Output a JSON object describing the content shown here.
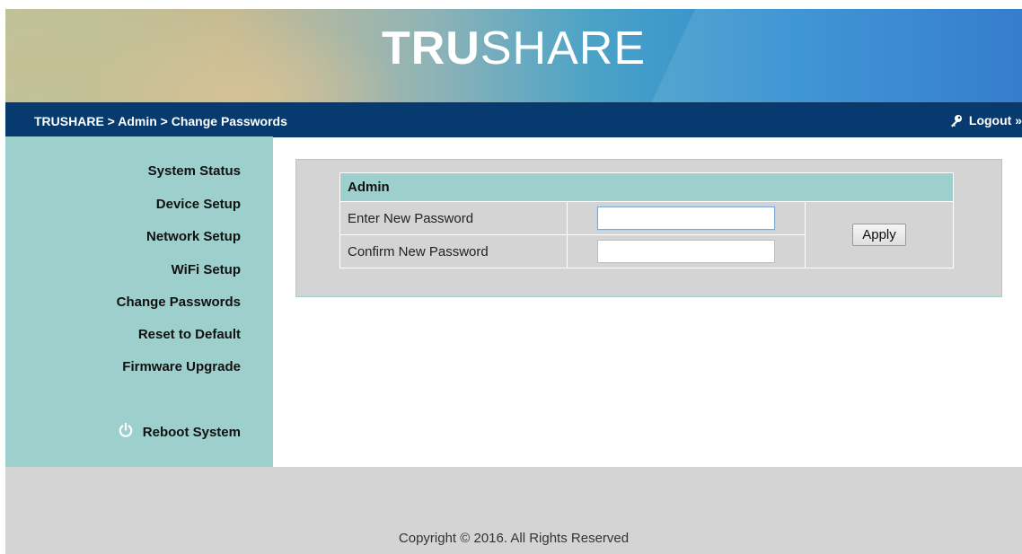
{
  "header": {
    "logo_bold": "TRU",
    "logo_light": "SHARE"
  },
  "navbar": {
    "breadcrumb": "TRUSHARE > Admin > Change Passwords",
    "logout_label": "Logout »"
  },
  "sidebar": {
    "items": [
      {
        "label": "System Status"
      },
      {
        "label": "Device Setup"
      },
      {
        "label": "Network Setup"
      },
      {
        "label": "WiFi Setup"
      },
      {
        "label": "Change Passwords"
      },
      {
        "label": "Reset to Default"
      },
      {
        "label": "Firmware Upgrade"
      }
    ],
    "reboot_label": "Reboot System",
    "reboot_icon": "power-icon"
  },
  "form": {
    "section_title": "Admin",
    "new_password_label": "Enter New Password",
    "new_password_value": "",
    "confirm_password_label": "Confirm New Password",
    "confirm_password_value": "",
    "apply_label": "Apply"
  },
  "footer": {
    "copyright": "Copyright © 2016. All Rights Reserved"
  },
  "colors": {
    "navbar": "#073a6e",
    "sidebar": "#9dcfcd",
    "panel": "#d4d4d4",
    "footer": "#d4d4d4",
    "reboot_icon": "#ffffff"
  }
}
